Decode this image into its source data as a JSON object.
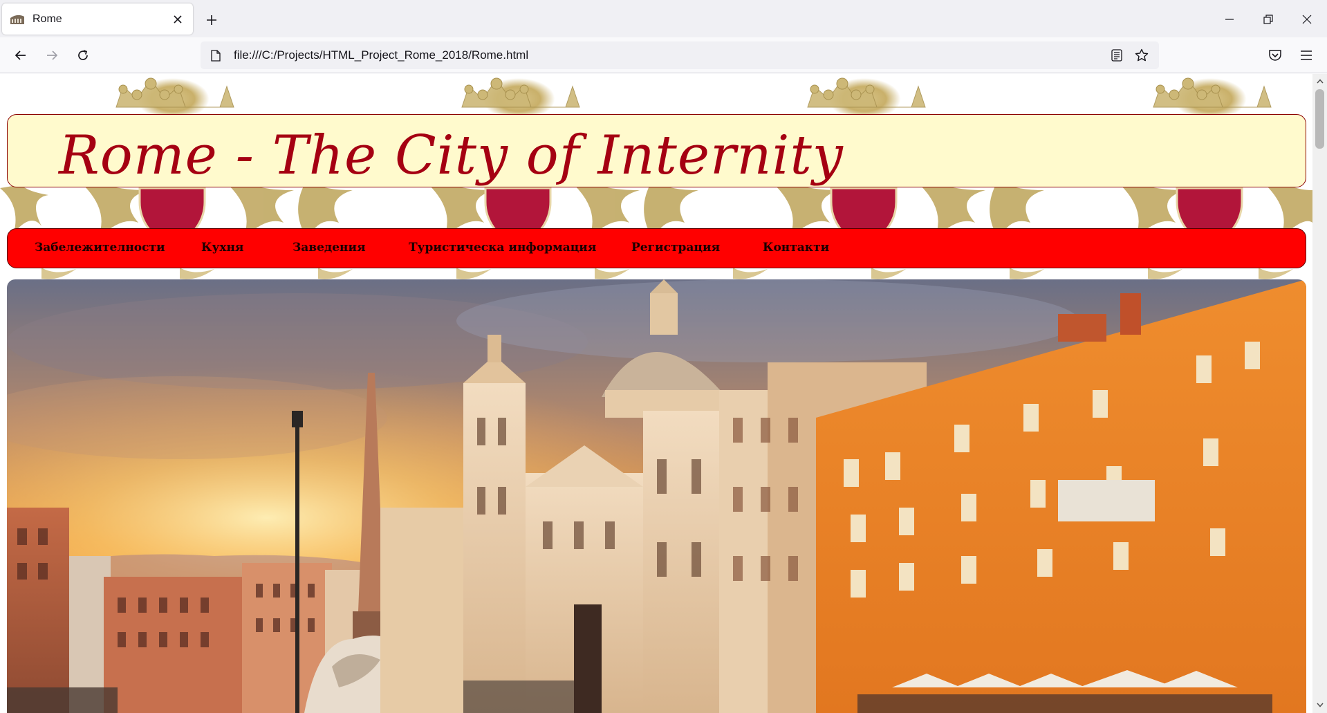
{
  "browser": {
    "tab": {
      "title": "Rome",
      "favicon": "colosseum-icon"
    },
    "url": "file:///C:/Projects/HTML_Project_Rome_2018/Rome.html",
    "icons": {
      "back": "back-arrow-icon",
      "forward": "forward-arrow-icon",
      "reload": "reload-icon",
      "reader": "reader-view-icon",
      "bookmark": "star-icon",
      "pocket": "pocket-icon",
      "menu": "hamburger-icon"
    }
  },
  "page": {
    "header_title": "Rome - The City of Internity",
    "menu": [
      {
        "label": "Забележителности"
      },
      {
        "label": "Кухня"
      },
      {
        "label": "Заведения"
      },
      {
        "label": "Туристическа информация"
      },
      {
        "label": "Регистрация"
      },
      {
        "label": "Контакти"
      }
    ],
    "colors": {
      "header_bg": "#fffacd",
      "header_text": "#a50012",
      "menu_bg": "#ff0000",
      "menu_text": "#1a0000"
    }
  }
}
